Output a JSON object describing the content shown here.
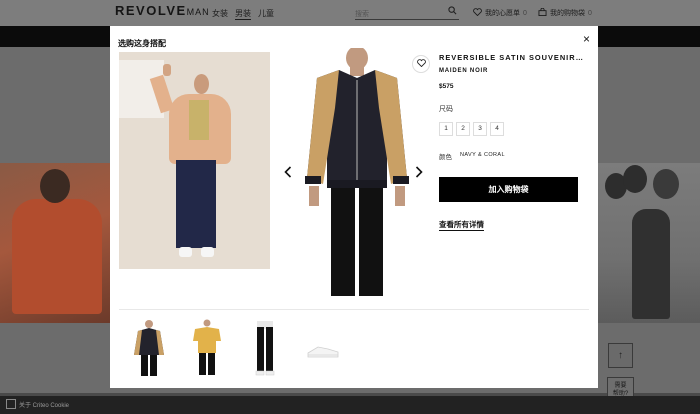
{
  "header": {
    "logo_main": "REVOLVE",
    "logo_sub": "MAN",
    "nav": [
      "女装",
      "男装",
      "儿童"
    ],
    "search_placeholder": "搜索",
    "wishlist_label": "我的心愿单",
    "wishlist_count": "0",
    "bag_label": "我的购物袋",
    "bag_count": "0"
  },
  "modal": {
    "title": "选购这身搭配",
    "close_label": "×"
  },
  "product": {
    "name": "REVERSIBLE SATIN SOUVENIR JACKET",
    "brand": "MAIDEN NOIR",
    "price": "$575",
    "size_label": "尺码",
    "sizes": [
      "1",
      "2",
      "3",
      "4"
    ],
    "color_label": "颜色",
    "color_value": "NAVY & CORAL",
    "add_to_bag": "加入购物袋",
    "view_details": "查看所有详情"
  },
  "thumbnails": [
    {
      "name": "jacket-thumbnail"
    },
    {
      "name": "tee-thumbnail"
    },
    {
      "name": "pants-thumbnail"
    },
    {
      "name": "sneaker-thumbnail"
    }
  ],
  "footer": {
    "cookie_text": "关于 Criteo Cookie",
    "help_line1": "需要",
    "help_line2": "帮助?",
    "scroll_top": "↑"
  },
  "icons": {
    "heart": "heart-icon",
    "bag": "bag-icon",
    "search": "search-icon",
    "close": "close-icon",
    "chevron_left": "chevron-left-icon",
    "chevron_right": "chevron-right-icon"
  },
  "colors": {
    "button_bg": "#000000",
    "overlay": "#4a4a4a"
  }
}
